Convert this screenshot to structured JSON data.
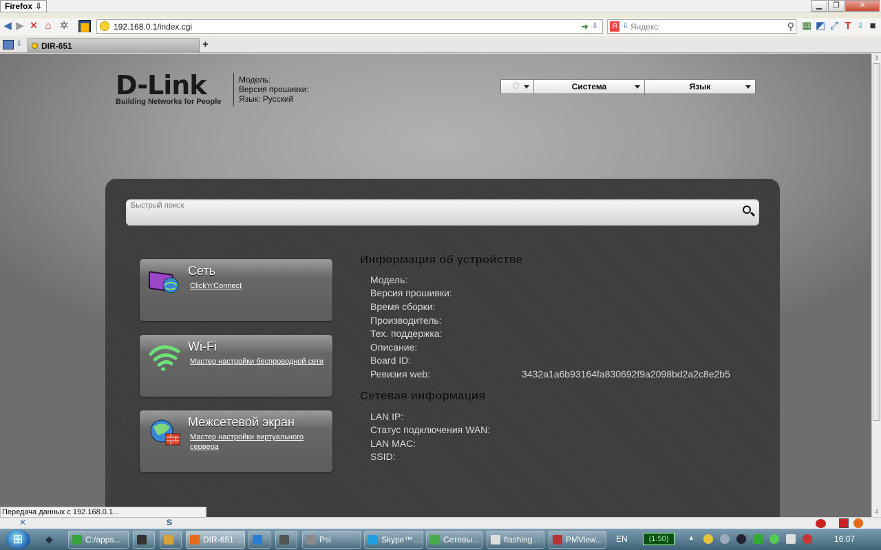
{
  "browser": {
    "menu_label": "Firefox",
    "url": "192.168.0.1/index.cgi",
    "search_placeholder": "Яндекс",
    "search_engine_badge": "Я",
    "tab_title": "DIR-651",
    "new_tab_label": "+",
    "status_text": "Передача данных с 192.168.0.1..."
  },
  "header": {
    "logo_text": "D-Link",
    "logo_tagline": "Building Networks for People",
    "model_label": "Модель:",
    "firmware_label": "Версия прошивки:",
    "language_label": "Язык: Русский"
  },
  "menu": {
    "tips_icon": "lightbulb-icon",
    "system_label": "Система",
    "language_label": "Язык"
  },
  "quick_search": {
    "placeholder": "Быстрый поиск"
  },
  "cards": [
    {
      "title": "Сеть",
      "link": "Click'n'Connect",
      "icon": "network-icon"
    },
    {
      "title": "Wi-Fi",
      "link": "Мастер настройки беспроводной сети",
      "icon": "wifi-icon"
    },
    {
      "title": "Межсетевой экран",
      "link": "Мастер настройки виртуального сервера",
      "icon": "firewall-icon"
    }
  ],
  "device_info": {
    "title": "Информация об устройстве",
    "rows": [
      {
        "label": "Модель:",
        "value": ""
      },
      {
        "label": "Версия прошивки:",
        "value": ""
      },
      {
        "label": "Время сборки:",
        "value": ""
      },
      {
        "label": "Производитель:",
        "value": ""
      },
      {
        "label": "Тех. поддержка:",
        "value": ""
      },
      {
        "label": "Описание:",
        "value": ""
      },
      {
        "label": "Board ID:",
        "value": ""
      },
      {
        "label": "Ревизия web:",
        "value": "3432a1a6b93164fa830692f9a2098bd2a2c8e2b5"
      }
    ]
  },
  "network_info": {
    "title": "Сетевая информация",
    "rows": [
      {
        "label": "LAN IP:",
        "value": ""
      },
      {
        "label": "Статус подключения WAN:",
        "value": ""
      },
      {
        "label": "LAN MAC:",
        "value": ""
      },
      {
        "label": "SSID:",
        "value": ""
      }
    ]
  },
  "taskbar": {
    "items": [
      {
        "label": "C:/apps...",
        "color": "#37a23a"
      },
      {
        "label": "",
        "color": "#333333"
      },
      {
        "label": "",
        "color": "#d6a23b"
      },
      {
        "label": "DIR-651 ...",
        "color": "#e56a1c"
      },
      {
        "label": "",
        "color": "#2a7fd4"
      },
      {
        "label": "",
        "color": "#555555"
      },
      {
        "label": "Psi",
        "color": "#8a8a8a"
      },
      {
        "label": "Skype™ ...",
        "color": "#1ea0e0"
      },
      {
        "label": "Сетевы...",
        "color": "#4aa94d"
      },
      {
        "label": "flashing...",
        "color": "#dddddd"
      },
      {
        "label": "PMView...",
        "color": "#b33"
      }
    ],
    "language": "EN",
    "battery": "(1:50)",
    "clock": "16:07"
  },
  "colors": {
    "panel_bg": "#3d3d3d",
    "page_bg": "#9c9c9c",
    "taskbar": "#4f7489"
  }
}
